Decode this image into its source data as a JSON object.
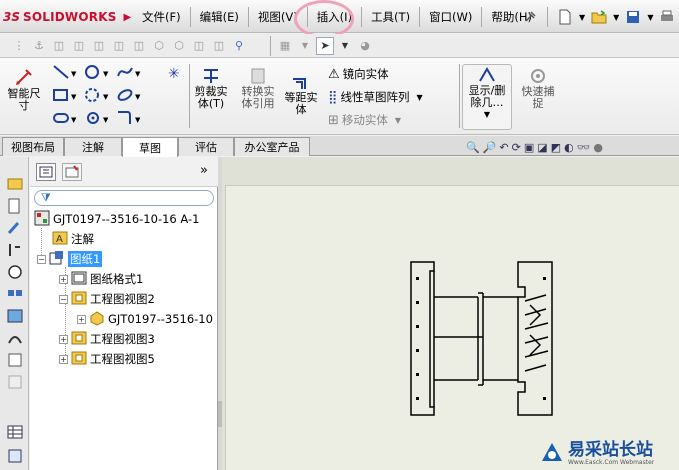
{
  "app": {
    "brand_ds": "3S",
    "brand_name": "SOLIDWORKS"
  },
  "menu": [
    "文件(F)",
    "编辑(E)",
    "视图(V)",
    "插入(I)",
    "工具(T)",
    "窗口(W)",
    "帮助(H)"
  ],
  "highlighted_menu": "插入(I)",
  "ribbon": {
    "smart_dim": "智能尺\n寸",
    "trim": "剪裁实\n体(T)",
    "convert": "转换实\n体引用",
    "offset": "等距实\n体",
    "mirror": "镜向实体",
    "linear_pattern": "线性草图阵列",
    "move": "移动实体",
    "display_delete": "显示/删\n除几…",
    "quick_snap": "快速捕\n捉"
  },
  "tabs": [
    "视图布局",
    "注解",
    "草图",
    "评估",
    "办公室产品"
  ],
  "active_tab": "草图",
  "tree": {
    "root": "GJT0197--3516-10-16 A-1",
    "annotations": "注解",
    "sheet": "图纸1",
    "sheet_format": "图纸格式1",
    "view2": "工程图视图2",
    "view2_model": "GJT0197--3516-10",
    "view3": "工程图视图3",
    "view5": "工程图视图5",
    "expand_chevron": "»"
  },
  "watermark": {
    "title": "易采站长站",
    "sub": "Www.Easck.Com Webmaster"
  },
  "colors": {
    "accent_red": "#c8102e",
    "ring_pink": "#f2a0b8",
    "selection_blue": "#3399ff",
    "canvas": "#dfe0d6"
  }
}
